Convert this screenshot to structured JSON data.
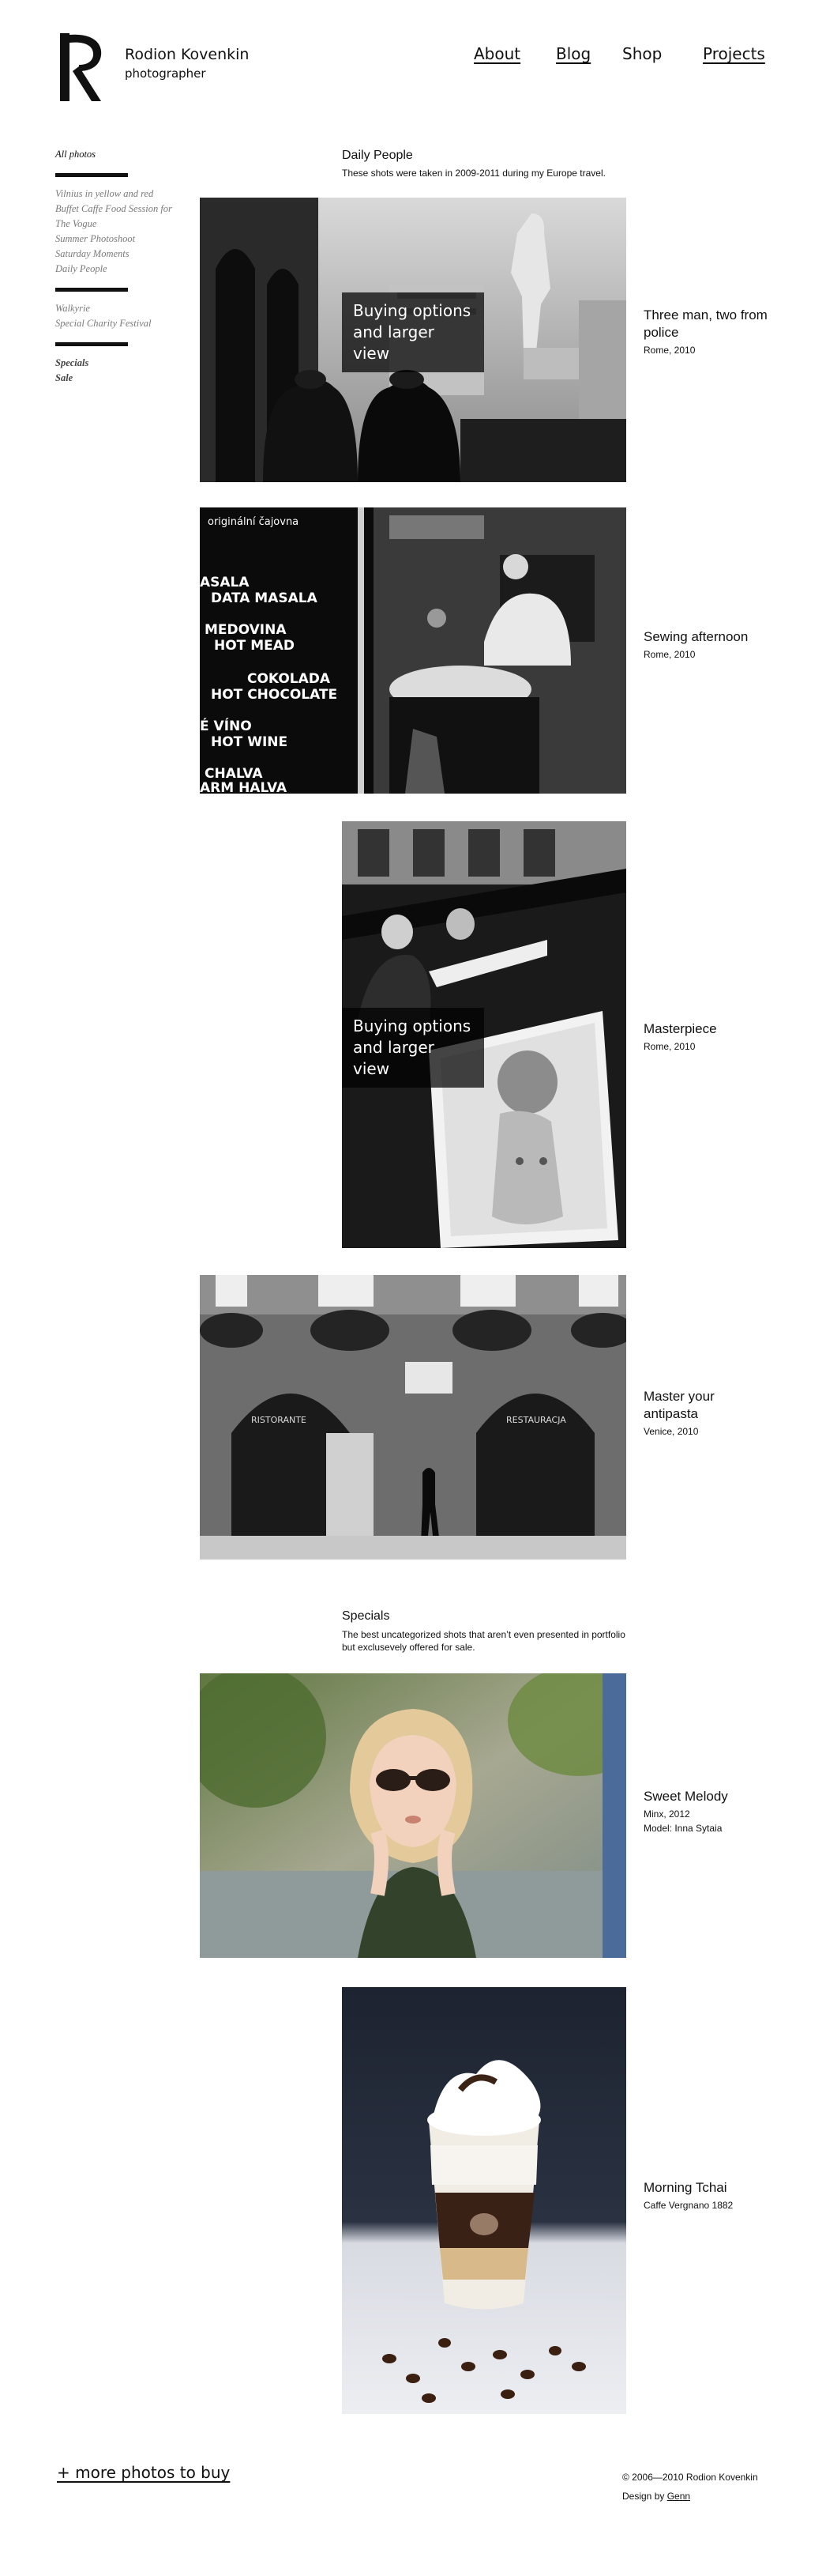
{
  "header": {
    "name": "Rodion Kovenkin",
    "role": "photographer",
    "nav": [
      {
        "label": "About",
        "underlined": true
      },
      {
        "label": "Blog",
        "underlined": true
      },
      {
        "label": "Shop",
        "underlined": false
      },
      {
        "label": "Projects",
        "underlined": true
      }
    ]
  },
  "sidebar": {
    "all": "All photos",
    "group1": [
      "Vilnius in yellow and red",
      "Buffet Caffe Food Session for The Vogue",
      "Summer Photoshoot",
      "Saturday Moments",
      "Daily People"
    ],
    "group2": [
      "Walkyrie",
      "Special Charity Festival"
    ],
    "group3": [
      "Specials",
      "Sale"
    ]
  },
  "sections": [
    {
      "title": "Daily People",
      "description": "These shots were taken in 2009-2011 during my Europe travel."
    },
    {
      "title": "Specials",
      "description": "The best uncategorized shots that aren’t even presented in portfolio but exclusevely offered for sale."
    }
  ],
  "overlay_label": "Buying options and larger view",
  "photos": [
    {
      "title": "Three man, two from police",
      "meta": [
        "Rome, 2010"
      ],
      "tone": "bw"
    },
    {
      "title": "Sewing afternoon",
      "meta": [
        "Rome, 2010"
      ],
      "tone": "bw",
      "sign": [
        "originální čajovna",
        "ASALA",
        "DATA MASALA",
        "MEDOVINA",
        "HOT MEAD",
        "COKOLADA",
        "HOT CHOCOLATE",
        "É VÍNO",
        "HOT WINE",
        "CHALVA",
        "ARM HALVA"
      ]
    },
    {
      "title": "Masterpiece",
      "meta": [
        "Rome, 2010"
      ],
      "tone": "bw"
    },
    {
      "title": "Master your antipasta",
      "meta": [
        "Venice, 2010"
      ],
      "tone": "bw",
      "sign": [
        "RISTORANTE",
        "RESTAURACJA"
      ]
    },
    {
      "title": "Sweet Melody",
      "meta": [
        "Minx, 2012",
        "Model: Inna Sytaia"
      ],
      "tone": "color"
    },
    {
      "title": "Morning Tchai",
      "meta": [
        "Caffe Vergnano 1882"
      ],
      "tone": "color"
    }
  ],
  "more_link": "+ more photos to buy",
  "footer": {
    "copyright": "© 2006—2010 Rodion Kovenkin",
    "design_prefix": "Design by ",
    "design_link": "Genn"
  },
  "colors": {
    "text": "#111111",
    "muted": "#7a7a7a",
    "overlay": "#000000",
    "background": "#ffffff"
  }
}
